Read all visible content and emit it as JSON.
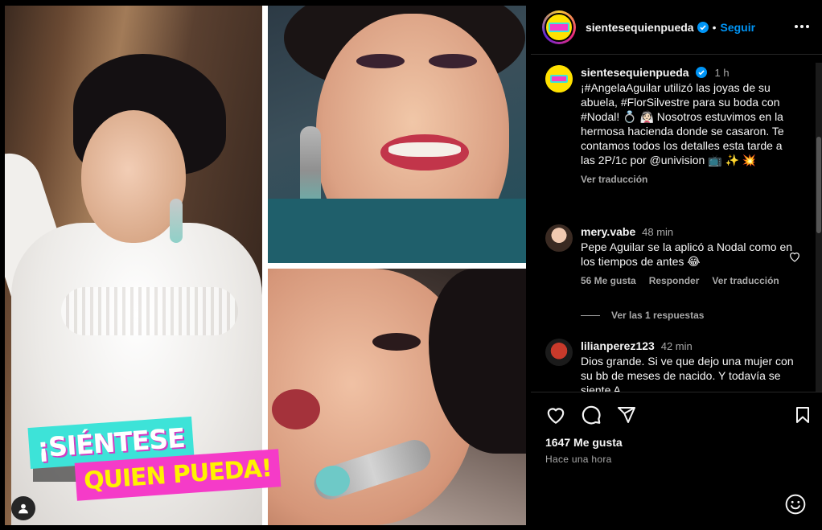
{
  "post": {
    "username": "sientesequienpueda",
    "follow_label": "Seguir",
    "separator": "•",
    "caption_time": "1 h",
    "caption_text": "¡#AngelaAguilar utilizó las joyas de su abuela, #FlorSilvestre para su boda con #Nodal! 💍 👰🏻 Nosotros estuvimos en la hermosa hacienda donde se casaron. Te contamos todos los detalles esta tarde a las 2P/1c por @univision 📺 ✨ 💥",
    "caption_translate": "Ver traducción",
    "likes": "1647 Me gusta",
    "posted": "Hace una hora"
  },
  "sticker": {
    "line1": "¡SIÉNTESE",
    "line2": "QUIEN PUEDA!"
  },
  "comments": [
    {
      "user": "mery.vabe",
      "time": "48 min",
      "text": "Pepe Aguilar se la aplicó a Nodal como en los tiempos de antes 😂",
      "likes": "56 Me gusta",
      "reply": "Responder",
      "translate": "Ver traducción",
      "replies": "Ver las 1 respuestas"
    },
    {
      "user": "lilianperez123",
      "time": "42 min",
      "text": "Dios grande. Si ve que dejo una mujer con su bb de meses de nacido. Y todavía se siente A"
    }
  ],
  "colors": {
    "accent": "#0095f6",
    "background": "#000000",
    "text": "#f5f5f5",
    "muted": "#a8a8a8",
    "sticker_cyan": "#3de3d8",
    "sticker_pink": "#f53bc8"
  },
  "icons": [
    "verified-badge-icon",
    "more-options-icon",
    "heart-icon",
    "comment-icon",
    "share-icon",
    "bookmark-icon",
    "emoji-icon",
    "user-tag-icon"
  ]
}
